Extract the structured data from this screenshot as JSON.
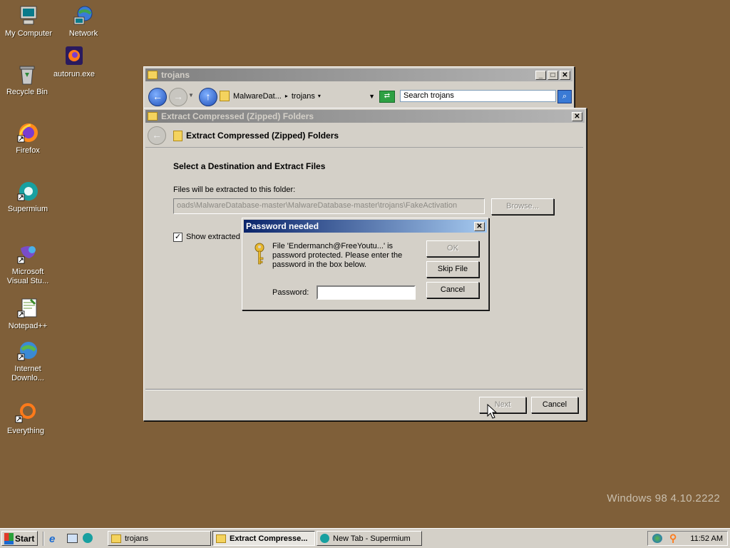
{
  "desktop": {
    "icons": [
      {
        "label": "My Computer"
      },
      {
        "label": "Network"
      },
      {
        "label": "autorun.exe"
      },
      {
        "label": "Recycle Bin"
      },
      {
        "label": "Firefox"
      },
      {
        "label": "Supermium"
      },
      {
        "label": "Microsoft Visual Stu..."
      },
      {
        "label": "Notepad++"
      },
      {
        "label": "Internet Downlo..."
      },
      {
        "label": "Everything"
      }
    ],
    "watermark": "Windows 98 4.10.2222"
  },
  "explorer": {
    "title": "trojans",
    "address": {
      "crumb1": "MalwareDat...",
      "crumb2": "trojans"
    },
    "search_placeholder": "Search trojans"
  },
  "extract_wizard": {
    "title": "Extract Compressed (Zipped) Folders",
    "header": "Extract Compressed (Zipped) Folders",
    "section_title": "Select a Destination and Extract Files",
    "path_label": "Files will be extracted to this folder:",
    "path_value": "oads\\MalwareDatabase-master\\MalwareDatabase-master\\trojans\\FakeActivation",
    "browse_label": "Browse...",
    "show_checkbox_label": "Show extracted",
    "show_checked": true,
    "next_label": "Next",
    "cancel_label": "Cancel"
  },
  "password_dialog": {
    "title": "Password needed",
    "message": "File 'Endermanch@FreeYoutu...' is password protected.  Please enter the password in the box below.",
    "password_label": "Password:",
    "password_value": "",
    "ok_label": "OK",
    "skip_label": "Skip File",
    "cancel_label": "Cancel"
  },
  "taskbar": {
    "start_label": "Start",
    "tasks": [
      {
        "label": "trojans"
      },
      {
        "label": "Extract Compresse..."
      },
      {
        "label": "New Tab - Supermium"
      }
    ],
    "clock": "11:52 AM"
  }
}
